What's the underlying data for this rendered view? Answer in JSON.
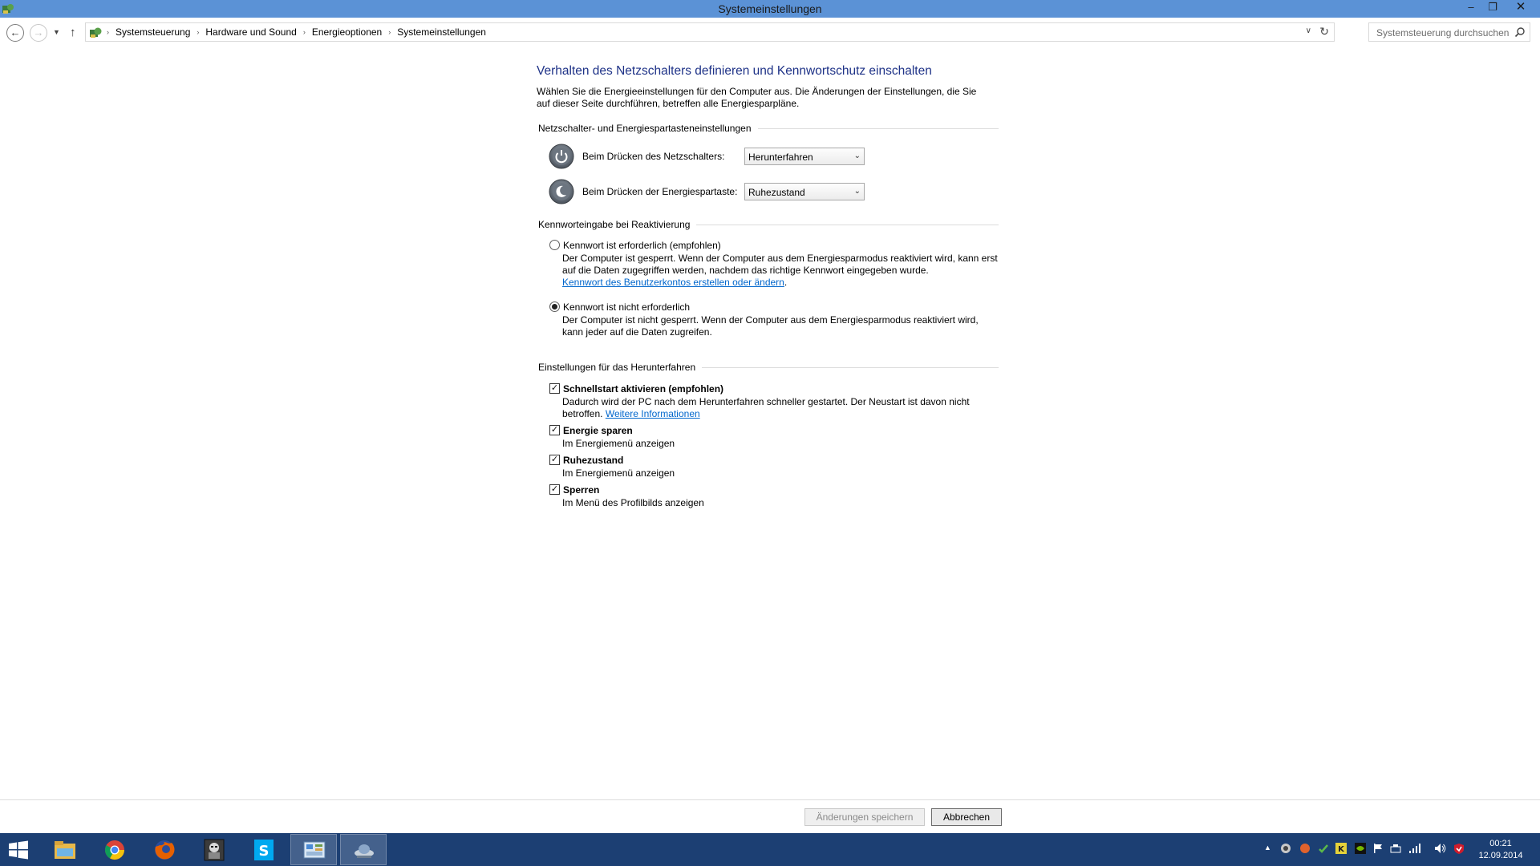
{
  "window": {
    "title": "Systemeinstellungen",
    "minimize": "–",
    "maximize": "❐",
    "close": "✕"
  },
  "nav": {
    "back": "←",
    "forward": "→",
    "recent": "▼",
    "up": "↑",
    "breadcrumb": [
      "Systemsteuerung",
      "Hardware und Sound",
      "Energieoptionen",
      "Systemeinstellungen"
    ],
    "separator": "›",
    "dropdown": "∨",
    "refresh": "↻",
    "search_placeholder": "Systemsteuerung durchsuchen"
  },
  "page": {
    "title": "Verhalten des Netzschalters definieren und Kennwortschutz einschalten",
    "intro": "Wählen Sie die Energieeinstellungen für den Computer aus. Die Änderungen der Einstellungen, die Sie auf dieser Seite durchführen, betreffen alle Energiesparpläne.",
    "section_power": "Netzschalter- und Energiespartasteneinstellungen",
    "power_button_label": "Beim Drücken des Netzschalters:",
    "power_button_value": "Herunterfahren",
    "sleep_button_label": "Beim Drücken der Energiespartaste:",
    "sleep_button_value": "Ruhezustand",
    "section_password": "Kennworteingabe bei Reaktivierung",
    "pw_required_label": "Kennwort ist erforderlich (empfohlen)",
    "pw_required_desc": "Der Computer ist gesperrt. Wenn der Computer aus dem Energiesparmodus reaktiviert wird, kann erst auf die Daten zugegriffen werden, nachdem das richtige Kennwort eingegeben wurde.",
    "pw_required_link": "Kennwort des Benutzerkontos erstellen oder ändern",
    "pw_not_required_label": "Kennwort ist nicht erforderlich",
    "pw_not_required_desc": "Der Computer ist nicht gesperrt. Wenn der Computer aus dem Energiesparmodus reaktiviert wird, kann jeder auf die Daten zugreifen.",
    "section_shutdown": "Einstellungen für das Herunterfahren",
    "fastboot_label": "Schnellstart aktivieren (empfohlen)",
    "fastboot_desc": "Dadurch wird der PC nach dem Herunterfahren schneller gestartet. Der Neustart ist davon nicht betroffen.",
    "fastboot_link": "Weitere Informationen",
    "sleep_label": "Energie sparen",
    "sleep_desc": "Im Energiemenü anzeigen",
    "hibernate_label": "Ruhezustand",
    "hibernate_desc": "Im Energiemenü anzeigen",
    "lock_label": "Sperren",
    "lock_desc": "Im Menü des Profilbilds anzeigen"
  },
  "state": {
    "password_required": false,
    "fastboot": true,
    "sleep": true,
    "hibernate": true,
    "lock": true
  },
  "footer": {
    "save": "Änderungen speichern",
    "cancel": "Abbrechen"
  },
  "taskbar": {
    "items": [
      "file-explorer-icon",
      "chrome-icon",
      "firefox-icon",
      "game-icon",
      "skype-icon",
      "control-panel-icon",
      "network-app-icon"
    ],
    "tray_up": "▲",
    "time": "00:21",
    "date": "12.09.2014"
  },
  "colors": {
    "titlebar": "#5b92d6",
    "title_text": "#1e3287",
    "link": "#0066cc",
    "taskbar": "#1c3f73"
  }
}
